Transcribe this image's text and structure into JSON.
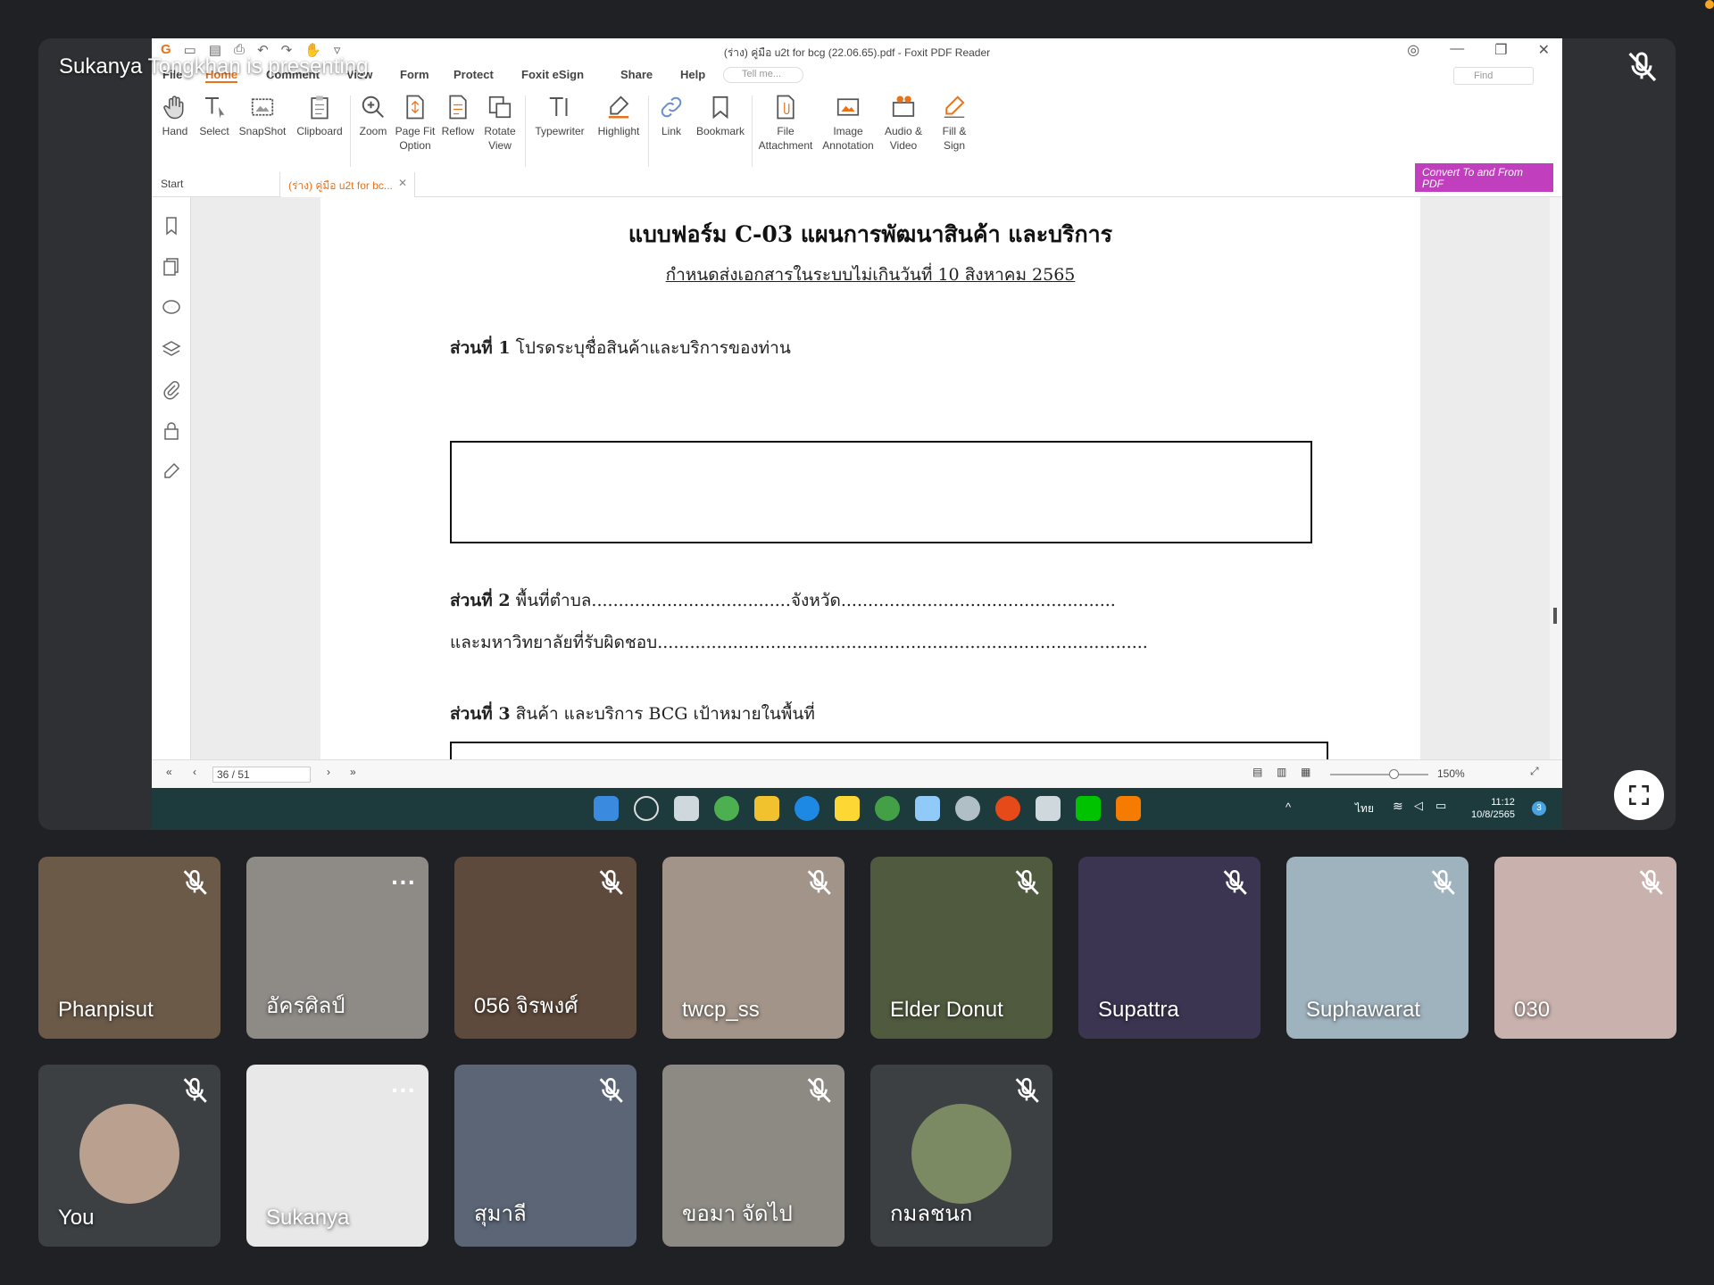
{
  "meeting": {
    "presenter_banner": "Sukanya Tongkhan is presenting"
  },
  "app": {
    "window_title": "(ร่าง) คู่มือ u2t for bcg (22.06.65).pdf - Foxit PDF Reader",
    "menu": [
      "File",
      "Home",
      "Comment",
      "View",
      "Form",
      "Protect",
      "Foxit eSign",
      "Share",
      "Help"
    ],
    "active_menu": "Home",
    "tell_me_placeholder": "Tell me...",
    "find_placeholder": "Find",
    "ribbon": [
      {
        "label": "Hand",
        "icon": "hand-icon"
      },
      {
        "label": "Select",
        "icon": "select-text-icon"
      },
      {
        "label": "SnapShot",
        "icon": "snapshot-icon"
      },
      {
        "label": "Clipboard",
        "icon": "clipboard-icon"
      },
      {
        "label": "Zoom",
        "icon": "zoom-icon"
      },
      {
        "label": "Page Fit Option",
        "icon": "page-fit-icon"
      },
      {
        "label": "Reflow",
        "icon": "reflow-icon"
      },
      {
        "label": "Rotate View",
        "icon": "rotate-view-icon"
      },
      {
        "label": "Typewriter",
        "icon": "typewriter-icon"
      },
      {
        "label": "Highlight",
        "icon": "highlight-icon"
      },
      {
        "label": "Link",
        "icon": "link-icon"
      },
      {
        "label": "Bookmark",
        "icon": "bookmark-icon"
      },
      {
        "label": "File Attachment",
        "icon": "file-attachment-icon"
      },
      {
        "label": "Image Annotation",
        "icon": "image-annotation-icon"
      },
      {
        "label": "Audio & Video",
        "icon": "audio-video-icon"
      },
      {
        "label": "Fill & Sign",
        "icon": "fill-sign-icon"
      }
    ],
    "convert_banner": "Convert To and From PDF",
    "tabs": {
      "start": "Start",
      "document": "(ร่าง) คู่มือ u2t for bc..."
    },
    "page_indicator": "36 / 51",
    "zoom": "150%",
    "accent": "#e8731b"
  },
  "document": {
    "title": "แบบฟอร์ม C-03  แผนการพัฒนาสินค้า และบริการ",
    "subtitle": "กำหนดส่งเอกสารในระบบไม่เกินวันที่ 10 สิงหาคม 2565",
    "section1_label": "ส่วนที่ 1",
    "section1_text": "โปรดระบุชื่อสินค้าและบริการของท่าน",
    "section2_label": "ส่วนที่ 2",
    "section2_text": "พื้นที่ตำบล.....................................จังหวัด...................................................",
    "section2_line2": "และมหาวิทยาลัยที่รับผิดชอบ...........................................................................................",
    "section3_label": "ส่วนที่ 3",
    "section3_text": "สินค้า และบริการ BCG เป้าหมายในพื้นที่"
  },
  "taskbar": {
    "language": "ไทย",
    "time": "11:12",
    "date": "10/8/2565",
    "notification_count": "3"
  },
  "participants": [
    {
      "name": "Phanpisut",
      "muted": true
    },
    {
      "name": "อัครศิลป์",
      "muted": false,
      "more": "..."
    },
    {
      "name": "056 จิรพงศ์",
      "muted": true
    },
    {
      "name": "twcp_ss",
      "muted": true
    },
    {
      "name": "Elder Donut",
      "muted": true
    },
    {
      "name": "Supattra",
      "muted": true
    },
    {
      "name": "Suphawarat",
      "muted": true
    },
    {
      "name": "030",
      "muted": true
    },
    {
      "name": "You",
      "muted": true
    },
    {
      "name": "Sukanya",
      "muted": false,
      "more": "..."
    },
    {
      "name": "สุมาลี",
      "muted": true
    },
    {
      "name": "ขอมา จัดไป",
      "muted": true
    },
    {
      "name": "กมลชนก",
      "muted": true
    }
  ]
}
